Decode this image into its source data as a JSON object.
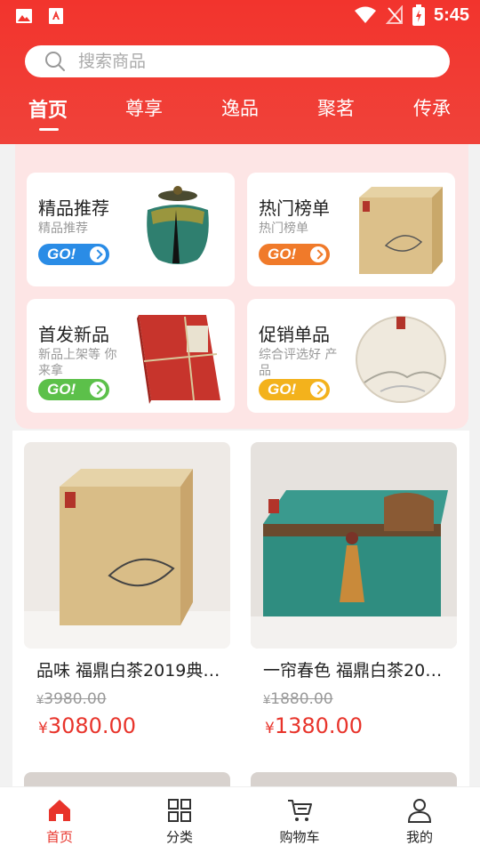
{
  "status_bar": {
    "time": "5:45"
  },
  "search": {
    "placeholder": "搜索商品"
  },
  "tabs": [
    {
      "label": "首页",
      "active": true
    },
    {
      "label": "尊享",
      "active": false
    },
    {
      "label": "逸品",
      "active": false
    },
    {
      "label": "聚茗",
      "active": false
    },
    {
      "label": "传承",
      "active": false
    }
  ],
  "promo": {
    "cards": [
      {
        "title": "精品推荐",
        "sub": "精品推荐",
        "go": "GO!",
        "color": "#2a8ce6"
      },
      {
        "title": "热门榜单",
        "sub": "热门榜单",
        "go": "GO!",
        "color": "#f07a2a"
      },
      {
        "title": "首发新品",
        "sub": "新品上架等 你来拿",
        "go": "GO!",
        "color": "#5cc04a"
      },
      {
        "title": "促销单品",
        "sub": "综合评选好 产品",
        "go": "GO!",
        "color": "#f3b21c"
      }
    ]
  },
  "products": [
    {
      "name": "品味 福鼎白茶2019典…",
      "old_currency": "¥",
      "old_price": "3980.00",
      "currency": "¥",
      "price": "3080.00"
    },
    {
      "name": "一帘春色 福鼎白茶20…",
      "old_currency": "¥",
      "old_price": "1880.00",
      "currency": "¥",
      "price": "1380.00"
    }
  ],
  "bottom_nav": [
    {
      "label": "首页",
      "icon": "home-icon",
      "active": true
    },
    {
      "label": "分类",
      "icon": "grid-icon",
      "active": false
    },
    {
      "label": "购物车",
      "icon": "cart-icon",
      "active": false
    },
    {
      "label": "我的",
      "icon": "user-icon",
      "active": false
    }
  ],
  "colors": {
    "brand_red": "#e8342b",
    "header_red": "#f2342d"
  }
}
